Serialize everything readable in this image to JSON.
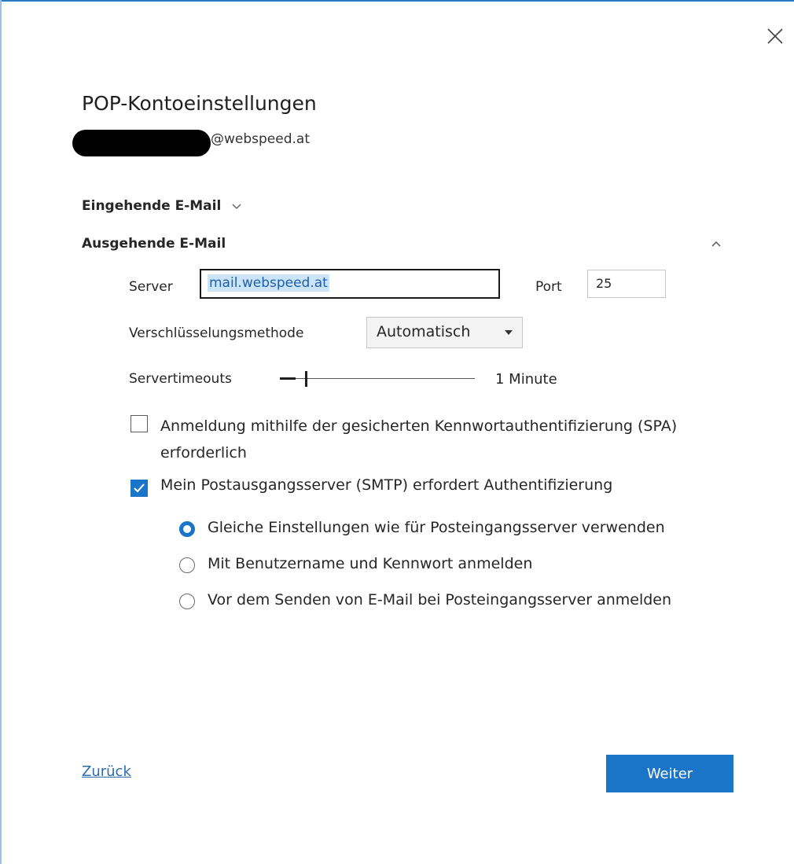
{
  "dialog": {
    "title": "POP-Kontoeinstellungen",
    "email_suffix": "@webspeed.at"
  },
  "sections": {
    "incoming_label": "Eingehende E-Mail",
    "outgoing_label": "Ausgehende E-Mail"
  },
  "outgoing": {
    "server_label": "Server",
    "server_value": "mail.webspeed.at",
    "port_label": "Port",
    "port_value": "25",
    "encryption_label": "Verschlüsselungsmethode",
    "encryption_value": "Automatisch",
    "timeout_label": "Servertimeouts",
    "timeout_value": "1 Minute",
    "timeout_level": 0.08,
    "spa_label": "Anmeldung mithilfe der gesicherten Kennwortauthentifizierung (SPA) erforderlich",
    "spa_checked": false,
    "smtp_auth_label": "Mein Postausgangsserver (SMTP) erfordert Authentifizierung",
    "smtp_auth_checked": true,
    "auth_options": [
      {
        "label": "Gleiche Einstellungen wie für Posteingangsserver verwenden",
        "selected": true
      },
      {
        "label": "Mit Benutzername und Kennwort anmelden",
        "selected": false
      },
      {
        "label": "Vor dem Senden von E-Mail bei Posteingangsserver anmelden",
        "selected": false
      }
    ]
  },
  "footer": {
    "back_label": "Zurück",
    "next_label": "Weiter"
  },
  "colors": {
    "accent": "#1a74c7",
    "link": "#2b6cb0"
  }
}
